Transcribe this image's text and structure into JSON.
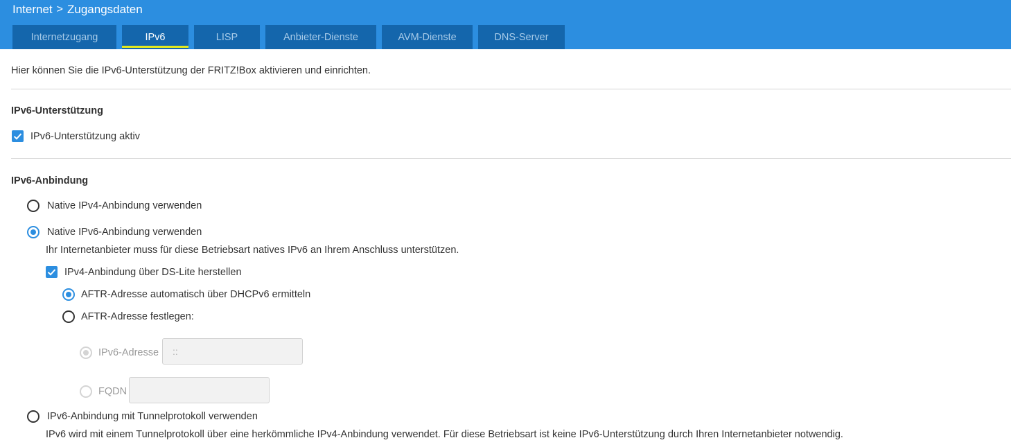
{
  "header": {
    "breadcrumb": {
      "parent": "Internet",
      "separator": ">",
      "current": "Zugangsdaten"
    },
    "tabs": [
      {
        "label": "Internetzugang",
        "active": false
      },
      {
        "label": "IPv6",
        "active": true
      },
      {
        "label": "LISP",
        "active": false
      },
      {
        "label": "Anbieter-Dienste",
        "active": false
      },
      {
        "label": "AVM-Dienste",
        "active": false
      },
      {
        "label": "DNS-Server",
        "active": false
      }
    ]
  },
  "intro": "Hier können Sie die IPv6-Unterstützung der FRITZ!Box aktivieren und einrichten.",
  "support": {
    "heading": "IPv6-Unterstützung",
    "checkbox_label": "IPv6-Unterstützung aktiv",
    "checked": true
  },
  "connection": {
    "heading": "IPv6-Anbindung",
    "options": [
      {
        "label": "Native IPv4-Anbindung verwenden",
        "selected": false
      },
      {
        "label": "Native IPv6-Anbindung verwenden",
        "selected": true,
        "description": "Ihr Internetanbieter muss für diese Betriebsart natives IPv6 an Ihrem Anschluss unterstützen.",
        "ds_lite": {
          "label": "IPv4-Anbindung über DS-Lite herstellen",
          "checked": true,
          "aftr_auto": {
            "label": "AFTR-Adresse automatisch über DHCPv6 ermitteln",
            "selected": true
          },
          "aftr_manual": {
            "label": "AFTR-Adresse festlegen:",
            "selected": false,
            "ipv6": {
              "label": "IPv6-Adresse",
              "value": "::",
              "selected": true
            },
            "fqdn": {
              "label": "FQDN",
              "value": "",
              "selected": false
            }
          }
        }
      },
      {
        "label": "IPv6-Anbindung mit Tunnelprotokoll verwenden",
        "selected": false,
        "description": "IPv6 wird mit einem Tunnelprotokoll über eine herkömmliche IPv4-Anbindung verwendet. Für diese Betriebsart ist keine IPv6-Unterstützung durch Ihren Internetanbieter notwendig."
      }
    ]
  },
  "colors": {
    "header_bg": "#2c8ee0",
    "tab_bg": "#1466ac",
    "tab_active_underline": "#e3e91d",
    "accent": "#2c8ee0"
  }
}
